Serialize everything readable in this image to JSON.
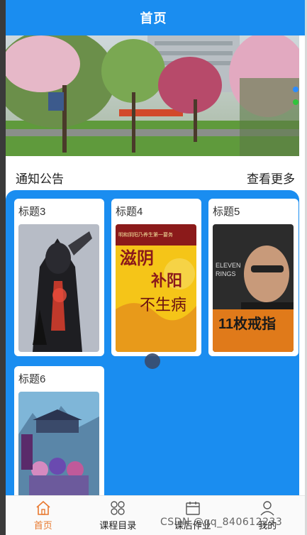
{
  "header": {
    "title": "首页"
  },
  "notice": {
    "title": "通知公告",
    "more_label": "查看更多"
  },
  "cards": [
    {
      "label": "标题3",
      "cover_icon": "dark-warrior-cover"
    },
    {
      "label": "标题4",
      "cover_icon": "health-book-cover",
      "cover_top": "明和阴阳乃养生第一要务",
      "cover_main": "滋阴",
      "cover_sub": "补阳",
      "cover_sub2": "不生病"
    },
    {
      "label": "标题5",
      "cover_icon": "eleven-rings-cover",
      "cover_en": "ELEVEN RINGS",
      "cover_cn": "11枚戒指"
    },
    {
      "label": "标题6",
      "cover_icon": "fantasy-novel-cover"
    }
  ],
  "tabs": [
    {
      "label": "首页",
      "icon": "home-icon",
      "active": true
    },
    {
      "label": "课程目录",
      "icon": "grid-icon",
      "active": false
    },
    {
      "label": "课后作业",
      "icon": "calendar-icon",
      "active": false
    },
    {
      "label": "我的",
      "icon": "user-icon",
      "active": false
    }
  ],
  "watermark": "CSDN @qq_840612233",
  "colors": {
    "primary": "#1a8df0",
    "active_tab": "#e8792f"
  }
}
